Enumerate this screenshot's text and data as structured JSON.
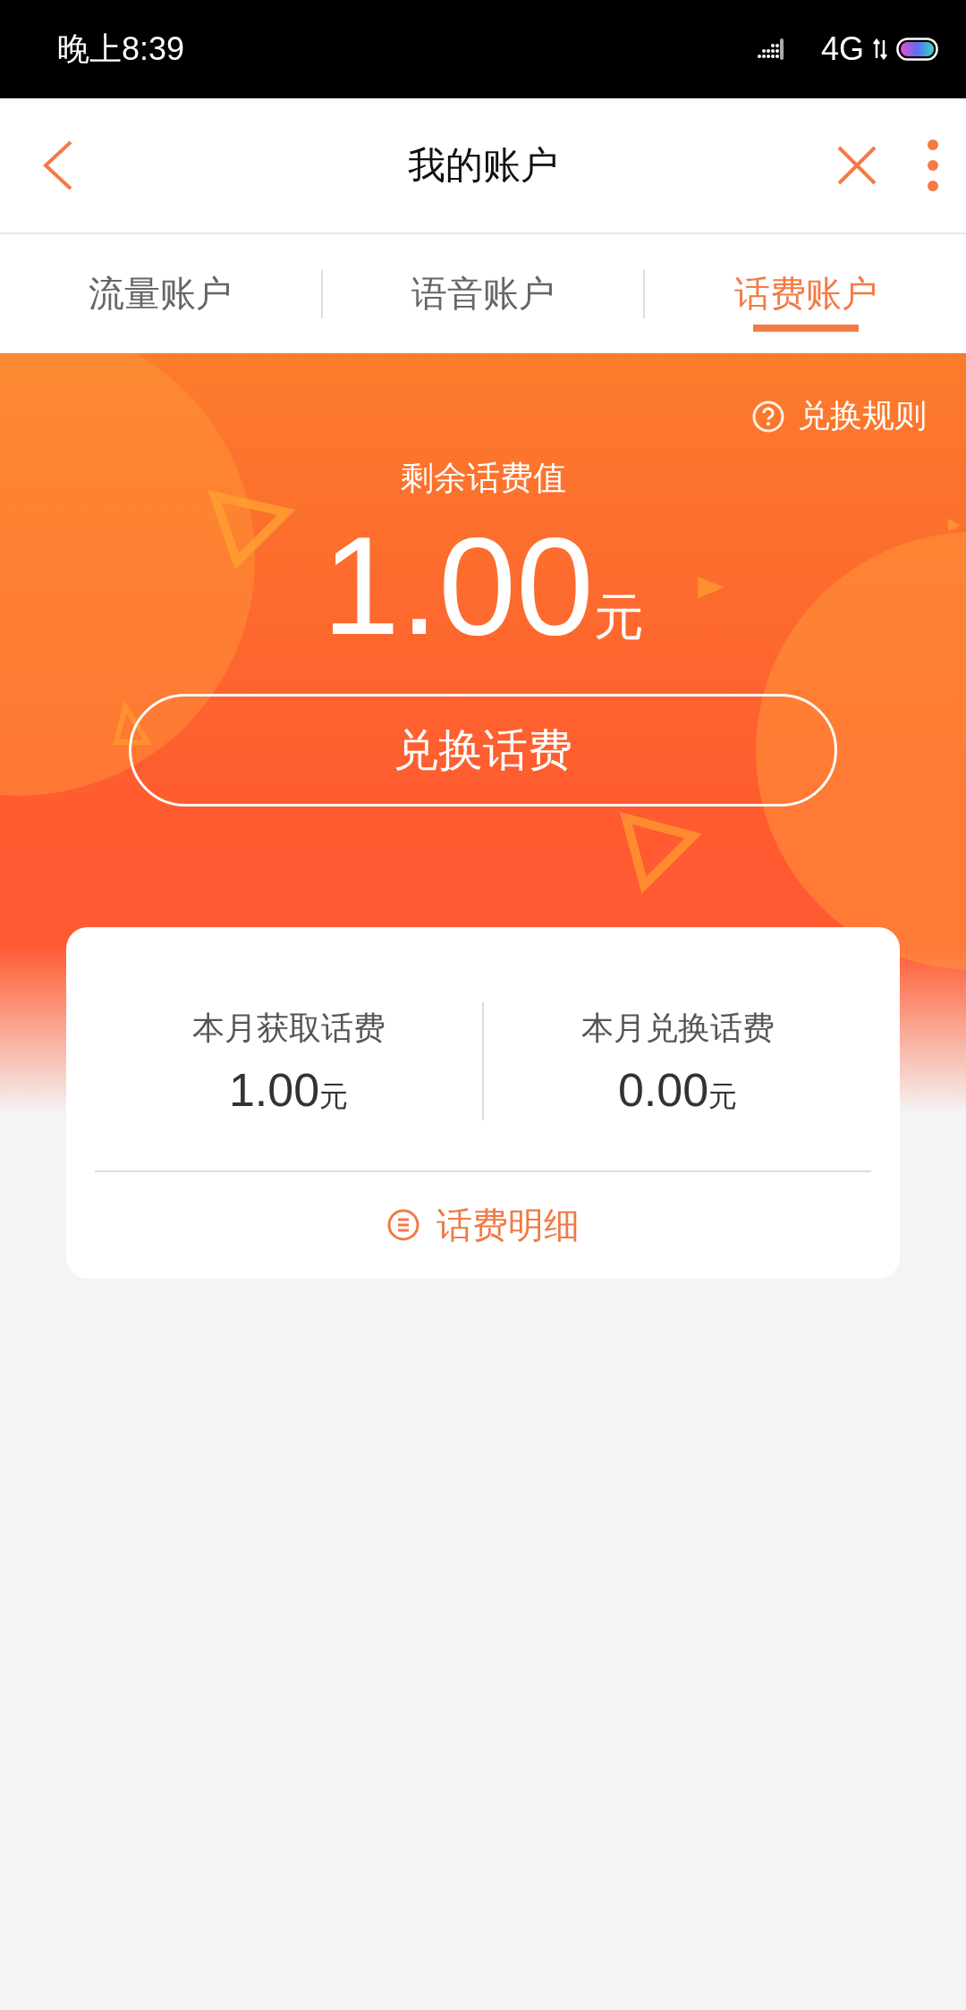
{
  "status_bar": {
    "time": "晚上8:39",
    "network": "4G"
  },
  "header": {
    "title": "我的账户"
  },
  "tabs": [
    {
      "label": "流量账户",
      "selected": false
    },
    {
      "label": "语音账户",
      "selected": false
    },
    {
      "label": "话费账户",
      "selected": true
    }
  ],
  "balance": {
    "rules_link": "兑换规则",
    "label": "剩余话费值",
    "amount": "1.00",
    "unit": "元",
    "button": "兑换话费"
  },
  "summary": {
    "stats": [
      {
        "label": "本月获取话费",
        "amount": "1.00",
        "unit": "元"
      },
      {
        "label": "本月兑换话费",
        "amount": "0.00",
        "unit": "元"
      }
    ],
    "details_link": "话费明细"
  }
}
